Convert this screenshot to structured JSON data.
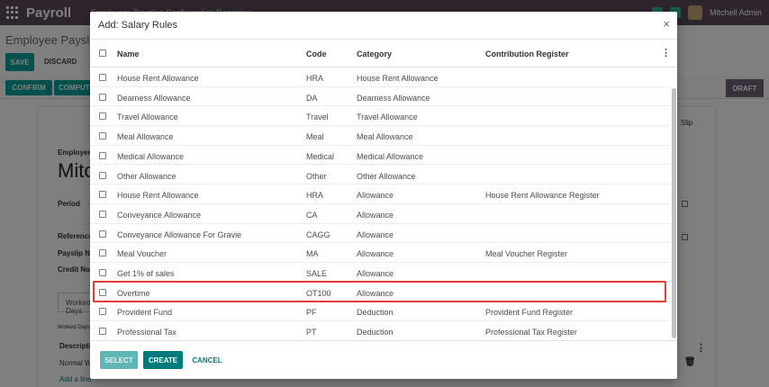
{
  "app": {
    "brand": "Payroll",
    "nav_menu": "Employees   Payslips   Configuration   Reporting",
    "user": "Mitchell Admin"
  },
  "background": {
    "breadcrumb": "Employee Payslips",
    "save_label": "SAVE",
    "discard_label": "DISCARD",
    "confirm_label": "CONFIRM",
    "compute_label": "COMPUTE",
    "stage_label": "DRAFT",
    "employee_label": "Employee",
    "employee_name": "Mitchell Admin",
    "period_label": "Period",
    "reference_label": "Reference",
    "payslip_label": "Payslip Name",
    "credit_label": "Credit Note",
    "tab_label": "Worked Days",
    "worked_label": "Worked Days",
    "desc_label": "Description",
    "normal_label": "Normal Working Days",
    "add_line": "Add a line",
    "slip_label": "Slip"
  },
  "modal": {
    "title": "Add: Salary Rules",
    "close_icon": "close-icon",
    "columns": [
      "Name",
      "Code",
      "Category",
      "Contribution Register"
    ],
    "rows": [
      {
        "name": "House Rent Allowance",
        "code": "HRA",
        "category": "House Rent Allowance",
        "register": ""
      },
      {
        "name": "Dearness Allowance",
        "code": "DA",
        "category": "Dearness Allowance",
        "register": ""
      },
      {
        "name": "Travel Allowance",
        "code": "Travel",
        "category": "Travel Allowance",
        "register": ""
      },
      {
        "name": "Meal Allowance",
        "code": "Meal",
        "category": "Meal Allowance",
        "register": ""
      },
      {
        "name": "Medical Allowance",
        "code": "Medical",
        "category": "Medical Allowance",
        "register": ""
      },
      {
        "name": "Other Allowance",
        "code": "Other",
        "category": "Other Allowance",
        "register": ""
      },
      {
        "name": "House Rent Allowance",
        "code": "HRA",
        "category": "Allowance",
        "register": "House Rent Allowance Register"
      },
      {
        "name": "Conveyance Allowance",
        "code": "CA",
        "category": "Allowance",
        "register": ""
      },
      {
        "name": "Conveyance Allowance For Gravie",
        "code": "CAGG",
        "category": "Allowance",
        "register": ""
      },
      {
        "name": "Meal Voucher",
        "code": "MA",
        "category": "Allowance",
        "register": "Meal Voucher Register"
      },
      {
        "name": "Get 1% of sales",
        "code": "SALE",
        "category": "Allowance",
        "register": ""
      },
      {
        "name": "Overtime",
        "code": "OT100",
        "category": "Allowance",
        "register": ""
      },
      {
        "name": "Provident Fund",
        "code": "PF",
        "category": "Deduction",
        "register": "Provident Fund Register"
      },
      {
        "name": "Professional Tax",
        "code": "PT",
        "category": "Deduction",
        "register": "Professional Tax Register"
      }
    ],
    "highlighted_row": "Overtime",
    "highlight_color": "#e53935",
    "footer": {
      "select_label": "SELECT",
      "create_label": "CREATE",
      "cancel_label": "CANCEL"
    }
  },
  "colors": {
    "navbar": "#5d4a59",
    "primary": "#00a09d",
    "create": "#00797a"
  }
}
